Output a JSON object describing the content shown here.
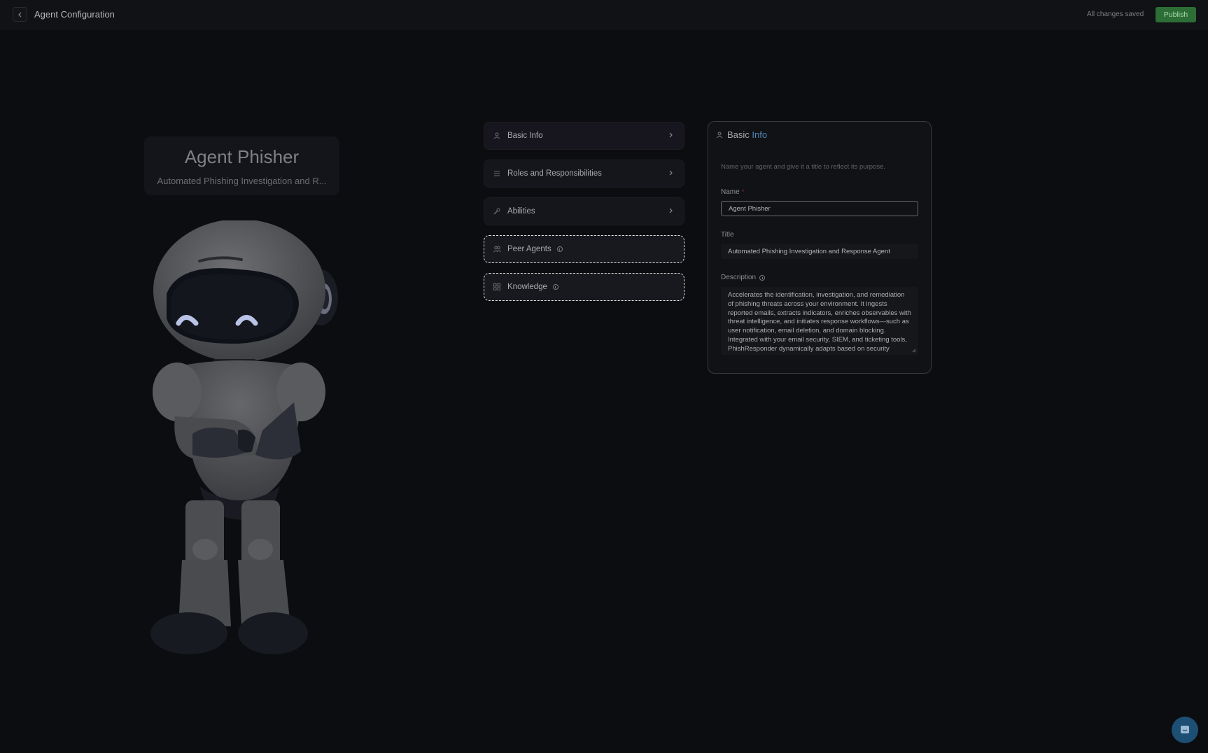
{
  "header": {
    "back_icon": "chevron-left-icon",
    "title": "Agent Configuration",
    "save_status": "All changes saved",
    "publish_label": "Publish"
  },
  "agent": {
    "name": "Agent Phisher",
    "subtitle": "Automated Phishing Investigation and R...",
    "image": "robot-illustration"
  },
  "nav": {
    "items": [
      {
        "label": "Basic Info",
        "icon": "user-icon",
        "state": "active"
      },
      {
        "label": "Roles and Responsibilities",
        "icon": "list-icon"
      },
      {
        "label": "Abilities",
        "icon": "wrench-icon"
      },
      {
        "label": "Peer Agents",
        "icon": "users-icon",
        "state": "dashed"
      },
      {
        "label": "Knowledge",
        "icon": "grid-icon",
        "state": "dashed"
      }
    ]
  },
  "panel": {
    "title_part1": "Basic ",
    "title_part2": "Info",
    "description": "Name your agent and give it a title to reflect its purpose.",
    "name_label": "Name",
    "required_mark": "*",
    "name_value": "Agent Phisher",
    "title_label": "Title",
    "title_value": "Automated Phishing Investigation and Response Agent",
    "description_label": "Description",
    "description_value": "Accelerates the identification, investigation, and remediation of phishing threats across your environment. It ingests reported emails, extracts indicators, enriches observables with threat intelligence, and initiates response workflows—such as user notification, email deletion, and domain blocking. Integrated with your email security, SIEM, and ticketing tools, PhishResponder dynamically adapts based on security context and policy, while collaborating with other agents"
  },
  "colors": {
    "background": "#0c0d10",
    "publish": "#2c6e36",
    "accent": "#4f86b3",
    "chat_button": "#1d4f75"
  },
  "chat": {
    "icon": "chat-icon"
  }
}
